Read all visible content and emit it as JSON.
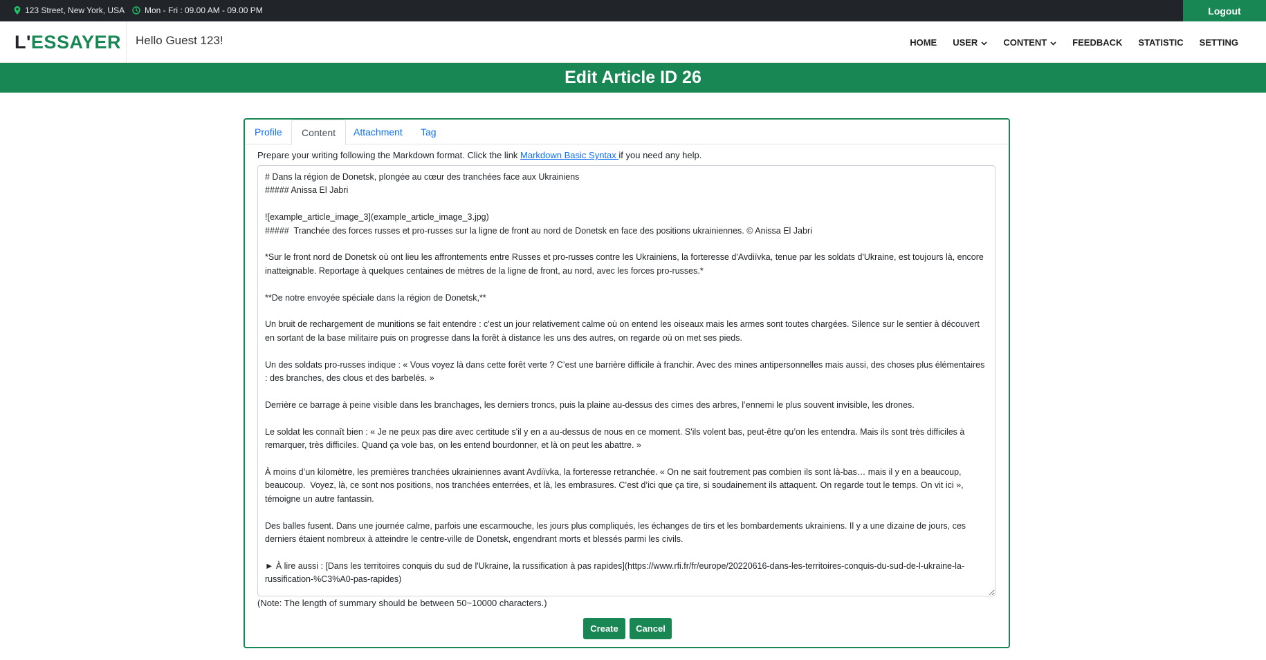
{
  "topbar": {
    "address": "123 Street, New York, USA",
    "hours": "Mon - Fri : 09.00 AM - 09.00 PM",
    "logout_label": "Logout"
  },
  "brand": {
    "part1": "L'",
    "part2": "ESSAYER"
  },
  "greeting": "Hello Guest 123!",
  "menu": {
    "home": "HOME",
    "user": "USER",
    "content": "CONTENT",
    "feedback": "FEEDBACK",
    "statistic": "STATISTIC",
    "setting": "SETTING"
  },
  "page_title": "Edit Article ID 26",
  "tabs": {
    "profile": "Profile",
    "content": "Content",
    "attachment": "Attachment",
    "tag": "Tag"
  },
  "hint": {
    "before": "Prepare your writing following the Markdown format. Click the link ",
    "link": "Markdown Basic Syntax ",
    "after": "if you need any help."
  },
  "editor_text": "# Dans la région de Donetsk, plongée au cœur des tranchées face aux Ukrainiens\n##### Anissa El Jabri\n\n![example_article_image_3](example_article_image_3.jpg)\n#####  Tranchée des forces russes et pro-russes sur la ligne de front au nord de Donetsk en face des positions ukrainiennes. © Anissa El Jabri\n\n*Sur le front nord de Donetsk où ont lieu les affrontements entre Russes et pro-russes contre les Ukrainiens, la forteresse d'Avdiïvka, tenue par les soldats d'Ukraine, est toujours là, encore inatteignable. Reportage à quelques centaines de mètres de la ligne de front, au nord, avec les forces pro-russes.*\n\n**De notre envoyée spéciale dans la région de Donetsk,**\n\nUn bruit de rechargement de munitions se fait entendre : c'est un jour relativement calme où on entend les oiseaux mais les armes sont toutes chargées. Silence sur le sentier à découvert en sortant de la base militaire puis on progresse dans la forêt à distance les uns des autres, on regarde où on met ses pieds.\n\nUn des soldats pro-russes indique : « Vous voyez là dans cette forêt verte ? C’est une barrière difficile à franchir. Avec des mines antipersonnelles mais aussi, des choses plus élémentaires : des branches, des clous et des barbelés. »\n\nDerrière ce barrage à peine visible dans les branchages, les derniers troncs, puis la plaine au-dessus des cimes des arbres, l’ennemi le plus souvent invisible, les drones.\n\nLe soldat les connaît bien : « Je ne peux pas dire avec certitude s'il y en a au-dessus de nous en ce moment. S'ils volent bas, peut-être qu’on les entendra. Mais ils sont très difficiles à remarquer, très difficiles. Quand ça vole bas, on les entend bourdonner, et là on peut les abattre. »\n\nÀ moins d’un kilomètre, les premières tranchées ukrainiennes avant Avdiïvka, la forteresse retranchée. « On ne sait foutrement pas combien ils sont là-bas… mais il y en a beaucoup, beaucoup.  Voyez, là, ce sont nos positions, nos tranchées enterrées, et là, les embrasures. C’est d’ici que ça tire, si soudainement ils attaquent. On regarde tout le temps. On vit ici », témoigne un autre fantassin.\n\nDes balles fusent. Dans une journée calme, parfois une escarmouche, les jours plus compliqués, les échanges de tirs et les bombardements ukrainiens. Il y a une dizaine de jours, ces derniers étaient nombreux à atteindre le centre-ville de Donetsk, engendrant morts et blessés parmi les civils.\n\n► À lire aussi : [Dans les territoires conquis du sud de l'Ukraine, la russification à pas rapides](https://www.rfi.fr/fr/europe/20220616-dans-les-territoires-conquis-du-sud-de-l-ukraine-la-russification-%C3%A0-pas-rapides)",
  "note": "(Note: The length of summary should be between 50~10000 characters.)",
  "buttons": {
    "create": "Create",
    "cancel": "Cancel"
  },
  "colors": {
    "accent": "#198754",
    "dark": "#212529",
    "link": "#0d6efd"
  }
}
